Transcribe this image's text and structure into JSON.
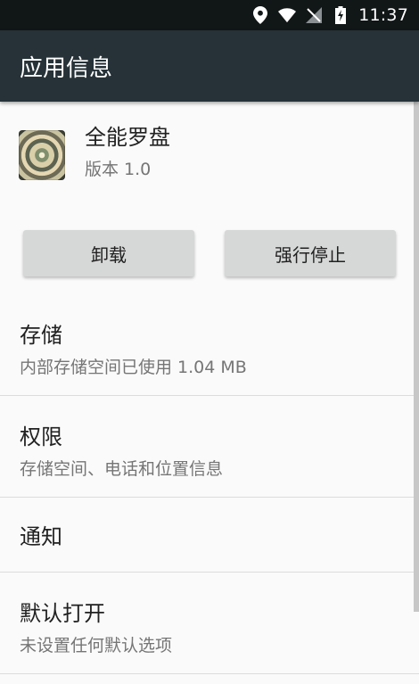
{
  "status_bar": {
    "time": "11:37",
    "icons": [
      "location-icon",
      "wifi-icon",
      "no-signal-icon",
      "battery-charging-icon"
    ]
  },
  "app_bar": {
    "title": "应用信息"
  },
  "app": {
    "name": "全能罗盘",
    "version": "版本 1.0"
  },
  "buttons": {
    "uninstall": "卸载",
    "force_stop": "强行停止"
  },
  "sections": {
    "storage": {
      "title": "存储",
      "subtitle": "内部存储空间已使用 1.04 MB"
    },
    "permissions": {
      "title": "权限",
      "subtitle": "存储空间、电话和位置信息"
    },
    "notifications": {
      "title": "通知"
    },
    "open_by_default": {
      "title": "默认打开",
      "subtitle": "未设置任何默认选项"
    }
  },
  "colors": {
    "status_bar": "#111617",
    "app_bar": "#263238",
    "background": "#fafafa",
    "button": "#d6d7d7"
  }
}
